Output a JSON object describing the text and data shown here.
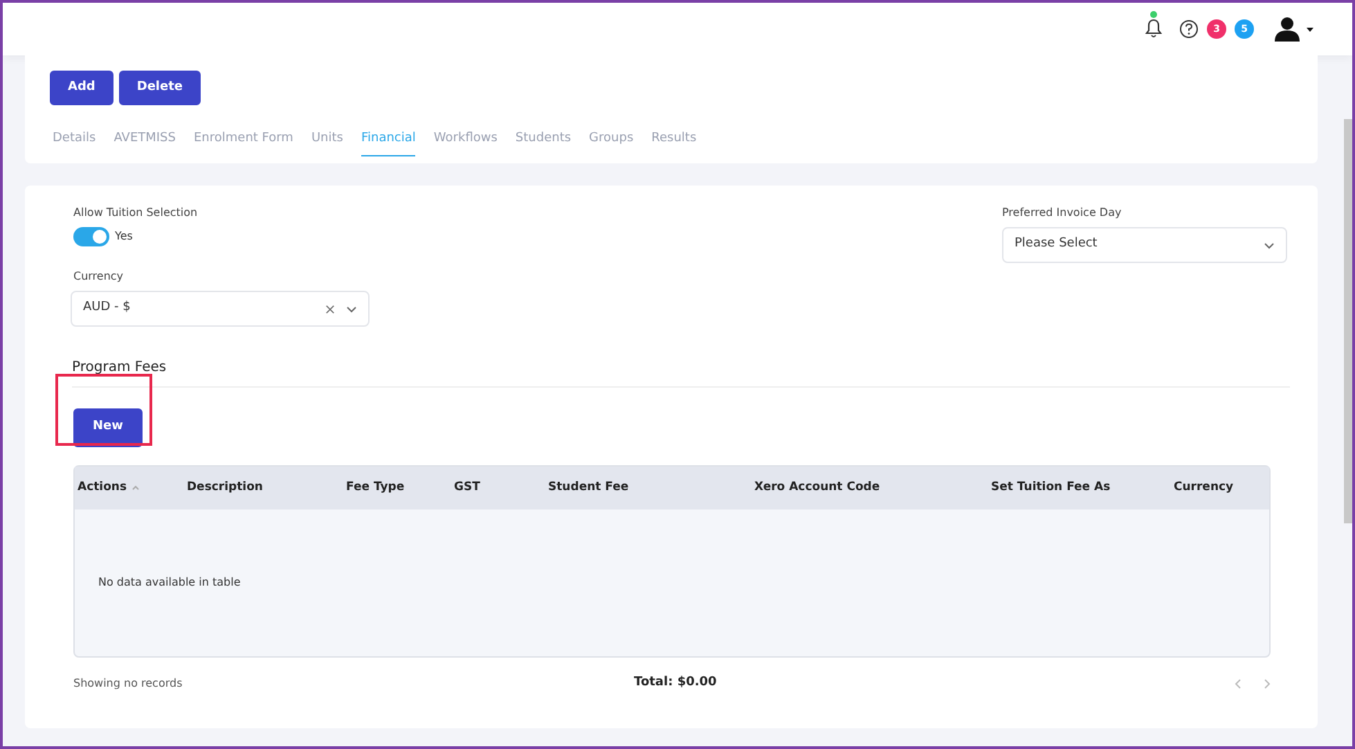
{
  "header": {
    "notification_dot": true,
    "badges": [
      {
        "count": "3",
        "color": "#f0306a"
      },
      {
        "count": "5",
        "color": "#1da1f2"
      }
    ]
  },
  "actions": [
    "Add",
    "Delete"
  ],
  "tabs": [
    {
      "label": "Details",
      "selected": false
    },
    {
      "label": "AVETMISS",
      "selected": false
    },
    {
      "label": "Enrolment Form",
      "selected": false
    },
    {
      "label": "Units",
      "selected": false
    },
    {
      "label": "Financial",
      "selected": true
    },
    {
      "label": "Workflows",
      "selected": false
    },
    {
      "label": "Students",
      "selected": false
    },
    {
      "label": "Groups",
      "selected": false
    },
    {
      "label": "Results",
      "selected": false
    }
  ],
  "allow_tuition": {
    "label": "Allow Tuition Selection",
    "on": true,
    "text": "Yes"
  },
  "invoice_day": {
    "label": "Preferred Invoice Day",
    "value": "Please Select"
  },
  "currency": {
    "label": "Currency",
    "value": "AUD - $"
  },
  "section_title": "Program Fees",
  "new_button": "New",
  "table": {
    "columns": [
      "Actions",
      "Description",
      "Fee Type",
      "GST",
      "Student Fee",
      "Xero Account Code",
      "Set Tuition Fee As",
      "Currency"
    ],
    "empty_text": "No data available in table"
  },
  "footer": {
    "info": "Showing no records",
    "total": "Total: $0.00"
  }
}
